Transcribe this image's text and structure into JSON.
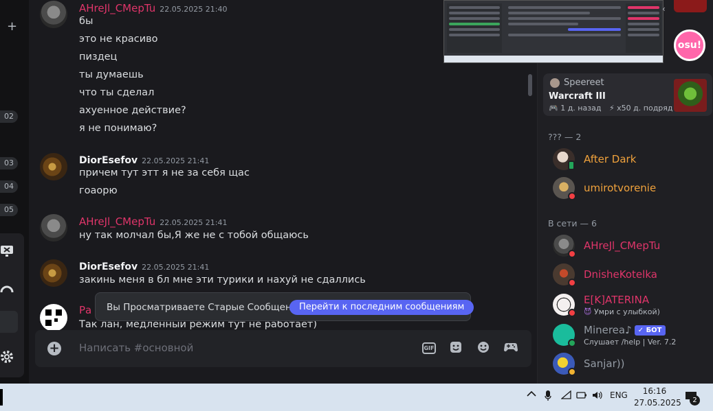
{
  "left_strip": {
    "plus": "+",
    "badges": [
      "02",
      "03",
      "04",
      "05"
    ]
  },
  "chat": {
    "groups": [
      {
        "author": "AHreJl_CMepTu",
        "time": "22.05.2025 21:40",
        "avatar": "helmet-avatar",
        "lines": [
          "бы",
          "это не красиво",
          "пиздец",
          "ты думаешь",
          "что ты сделал",
          "ахуенное действие?",
          "я не понимаю?"
        ]
      },
      {
        "author": "DiorEsefov",
        "time": "22.05.2025 21:41",
        "avatar": "gold-avatar",
        "lines": [
          "причем тут этт я не за себя щас",
          "гоаорю"
        ]
      },
      {
        "author": "AHreJl_CMepTu",
        "time": "22.05.2025 21:41",
        "avatar": "helmet-avatar",
        "lines": [
          "ну так молчал бы,Я же не с тобой общаюсь"
        ]
      },
      {
        "author": "DiorEsefov",
        "time": "22.05.2025 21:41",
        "avatar": "gold-avatar",
        "lines": [
          "закинь меня в бл мне эти турики и нахуй не сдаллись"
        ]
      },
      {
        "author": "Ра",
        "time": "",
        "avatar": "qr-avatar",
        "lines": [
          "Так лан, медленный режим тут не работает)"
        ]
      }
    ],
    "old_messages_banner": {
      "text": "Вы Просматриваете Старые Сообщения",
      "button": "Перейти к последним сообщениям"
    },
    "composer": {
      "placeholder": "Написать #основной",
      "gif_label": "GIF"
    }
  },
  "members": {
    "activity": {
      "user": "Speereet",
      "game": "Warcraft III",
      "ago": "1 д. назад",
      "streak": "x50 д. подряд"
    },
    "group1": {
      "title": "??? — 2",
      "list": [
        {
          "name": "After Dark",
          "sub": ""
        },
        {
          "name": "umirotvorenie",
          "sub": ""
        }
      ]
    },
    "group2": {
      "title": "В сети — 6",
      "list": [
        {
          "name": "AHreJl_CMepTu",
          "sub": ""
        },
        {
          "name": "DnisheKotelka",
          "sub": ""
        },
        {
          "name": "E[K]ATERINA",
          "sub": "Умри с улыбкой)"
        },
        {
          "name": "Minerea♪",
          "sub": "Слушает /help | Ver. 7.2",
          "badge": "БОТ"
        },
        {
          "name": "Sanjar))",
          "sub": ""
        }
      ]
    },
    "osu_label": "osu!"
  },
  "taskbar": {
    "lang": "ENG",
    "time": "16:16",
    "date": "27.05.2025",
    "notifications": "2"
  },
  "colors": {
    "accent": "#5865f2",
    "red_name": "#e0356a",
    "orange_name": "#f0a23c",
    "dnd": "#f23f43",
    "online": "#23a55a"
  }
}
